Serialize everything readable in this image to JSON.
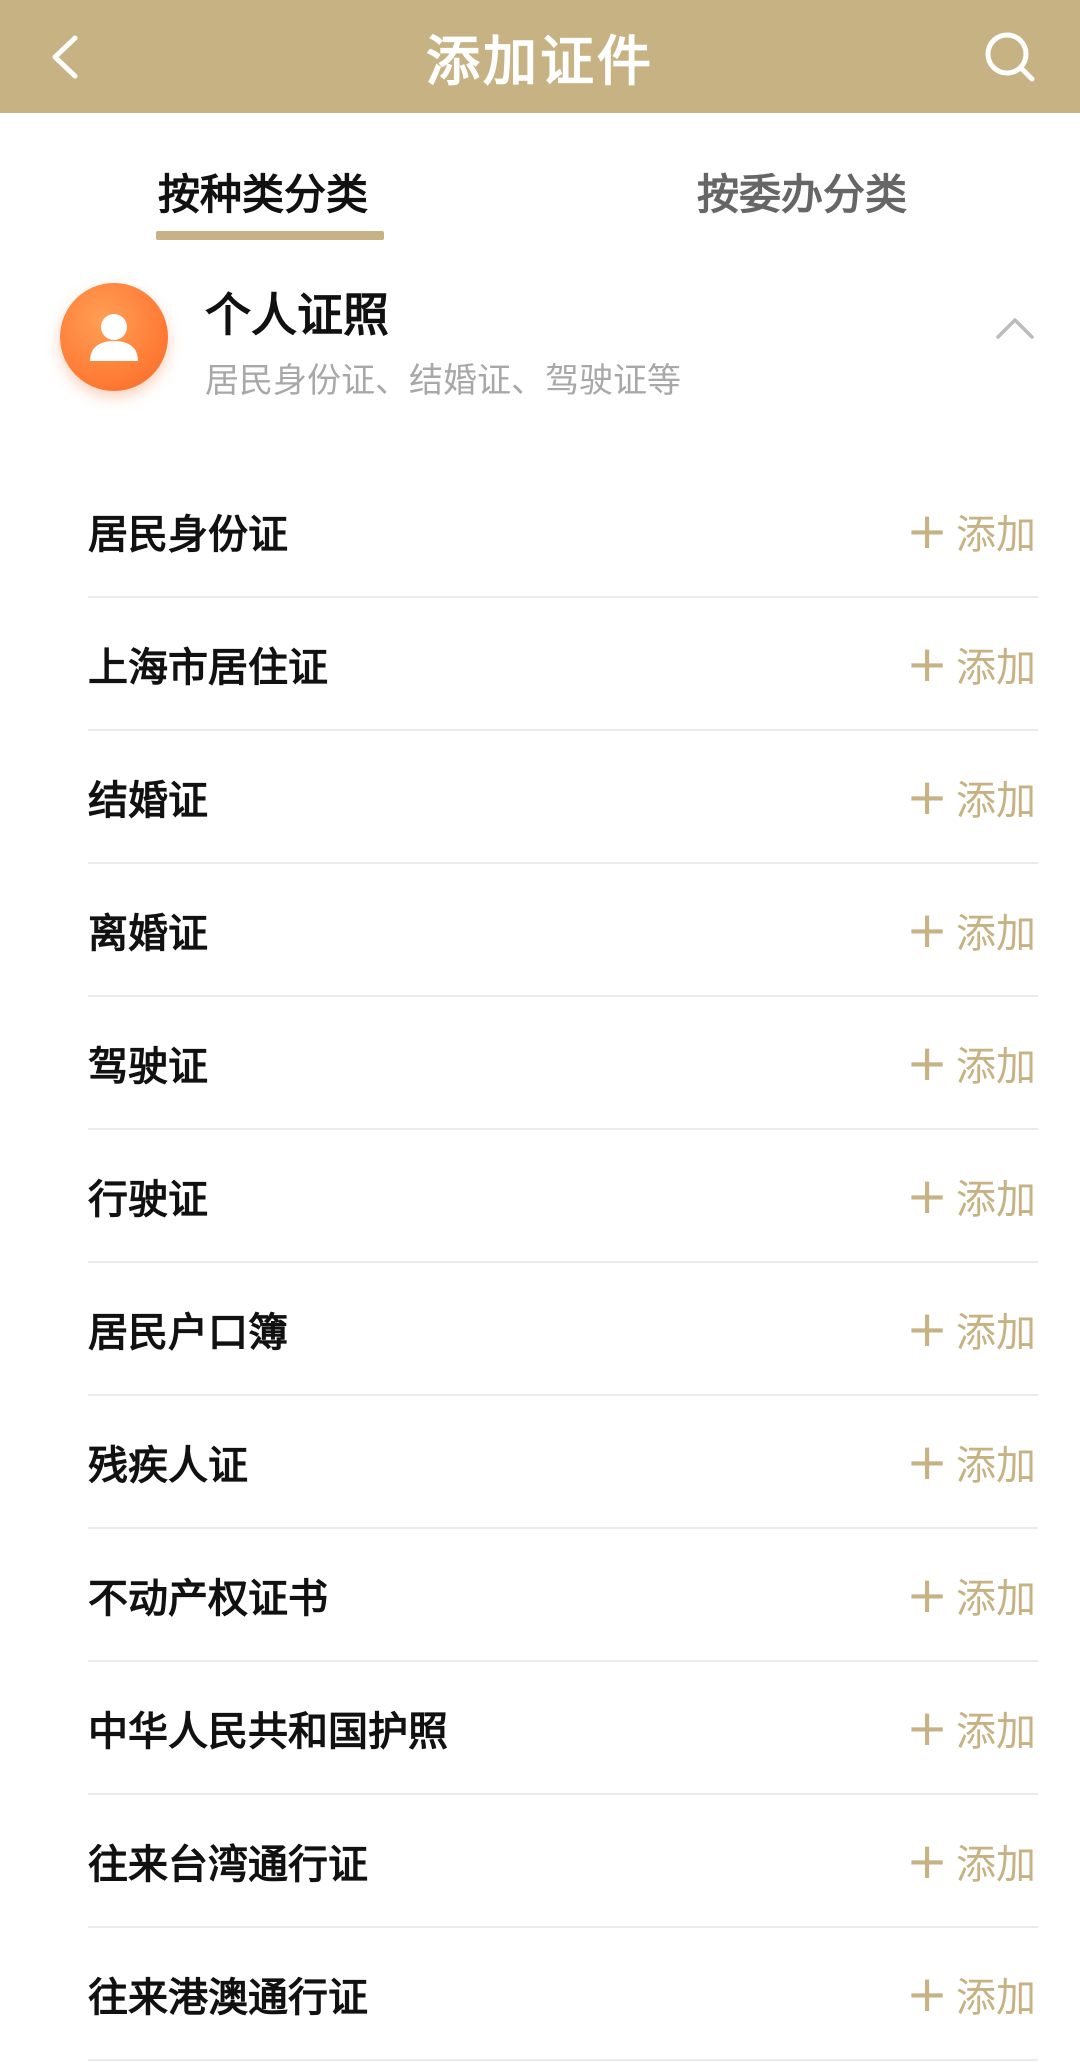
{
  "header": {
    "title": "添加证件",
    "back_icon": "chevron-left-icon",
    "search_icon": "search-icon",
    "background_color": "#c6b283"
  },
  "tabs": [
    {
      "label": "按种类分类",
      "active": true
    },
    {
      "label": "按委办分类",
      "active": false
    }
  ],
  "category": {
    "title": "个人证照",
    "subtitle": "居民身份证、结婚证、驾驶证等",
    "icon": "person-icon",
    "icon_color": "#ff7d37",
    "expanded": true
  },
  "add_label": "添加",
  "accent_color": "#c6b283",
  "items": [
    {
      "label": "居民身份证"
    },
    {
      "label": "上海市居住证"
    },
    {
      "label": "结婚证"
    },
    {
      "label": "离婚证"
    },
    {
      "label": "驾驶证"
    },
    {
      "label": "行驶证"
    },
    {
      "label": "居民户口簿"
    },
    {
      "label": "残疾人证"
    },
    {
      "label": "不动产权证书"
    },
    {
      "label": "中华人民共和国护照"
    },
    {
      "label": "往来台湾通行证"
    },
    {
      "label": "往来港澳通行证"
    }
  ]
}
